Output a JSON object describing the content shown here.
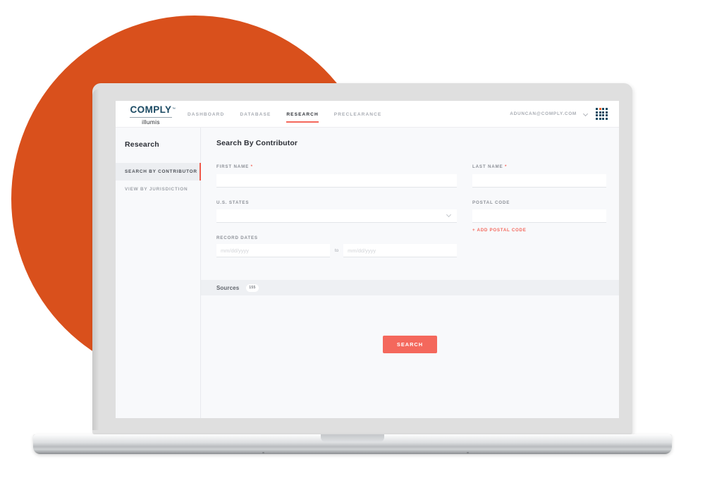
{
  "brand": {
    "logo_word": "COMPLY",
    "logo_tm": "™",
    "logo_sub": "illumis",
    "navy": "#174b63",
    "accent_coral": "#f4685c",
    "accent_orange": "#d9501c"
  },
  "header": {
    "nav": [
      {
        "label": "DASHBOARD",
        "active": false
      },
      {
        "label": "DATABASE",
        "active": false
      },
      {
        "label": "RESEARCH",
        "active": true
      },
      {
        "label": "PRECLEARANCE",
        "active": false
      }
    ],
    "user_email": "ADUNCAN@COMPLY.COM",
    "chevron_icon": "chevron-down-icon",
    "apps_icon": "app-grid-icon"
  },
  "sidebar": {
    "title": "Research",
    "items": [
      {
        "label": "SEARCH BY CONTRIBUTOR",
        "active": true
      },
      {
        "label": "VIEW BY JURISDICTION",
        "active": false
      }
    ]
  },
  "main": {
    "title": "Search By Contributor",
    "fields": {
      "first_name": {
        "label": "FIRST NAME",
        "required": "*",
        "value": "",
        "placeholder": ""
      },
      "last_name": {
        "label": "LAST NAME",
        "required": "*",
        "value": "",
        "placeholder": ""
      },
      "us_states": {
        "label": "U.S. STATES",
        "value": "",
        "placeholder": "",
        "caret_icon": "chevron-down-icon"
      },
      "postal_code": {
        "label": "POSTAL CODE",
        "value": "",
        "placeholder": ""
      },
      "add_postal_code": {
        "label": "+ ADD POSTAL CODE"
      },
      "record_dates": {
        "label": "RECORD DATES",
        "from_value": "",
        "from_placeholder": "mm/dd/yyyy",
        "separator": "to",
        "to_value": "",
        "to_placeholder": "mm/dd/yyyy"
      }
    },
    "sources": {
      "label": "Sources",
      "count": "155"
    },
    "search_button": "SEARCH"
  }
}
